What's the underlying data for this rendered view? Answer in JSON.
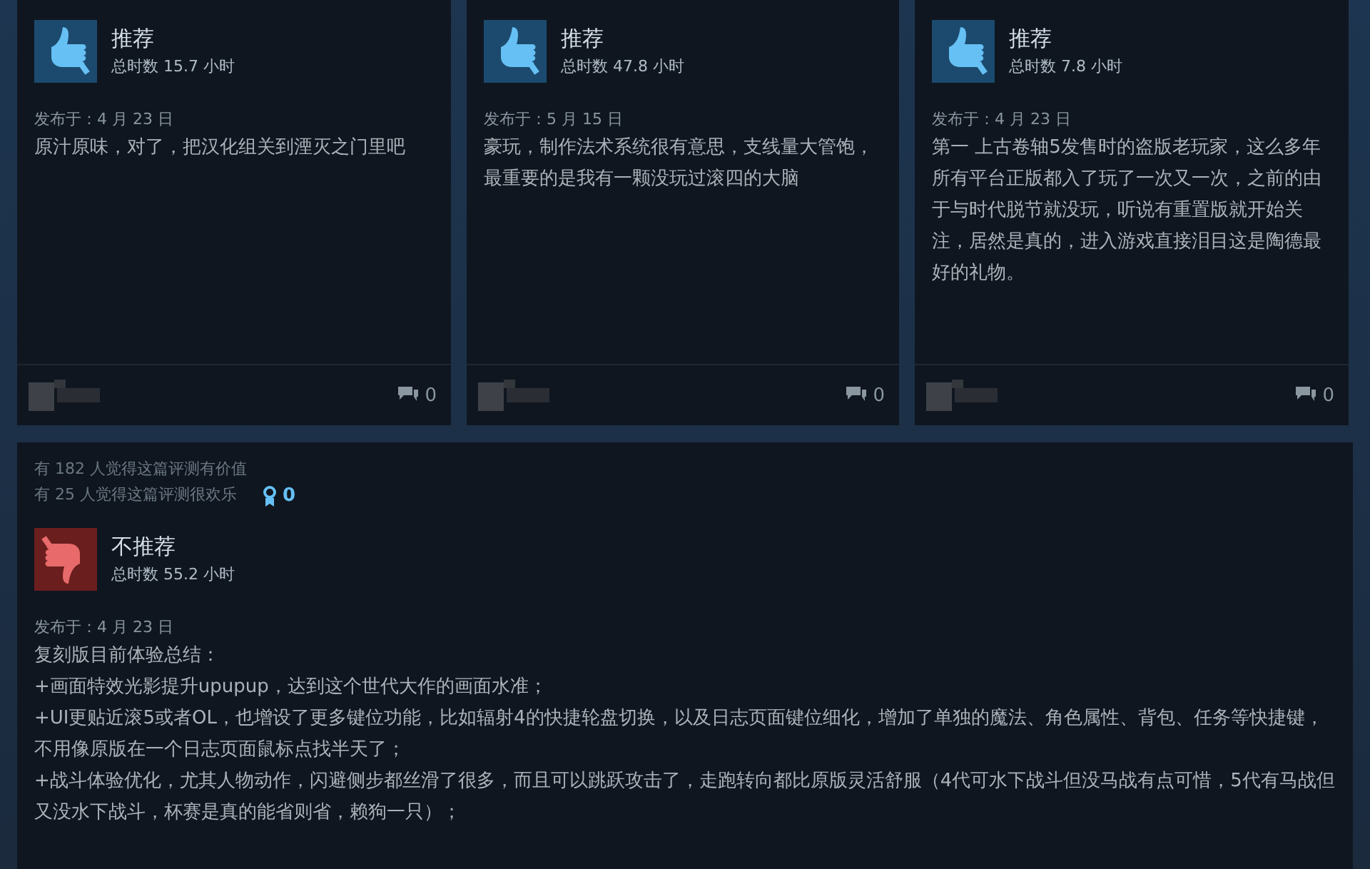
{
  "reviews": [
    {
      "recommended": true,
      "verdict": "推荐",
      "hours": "总时数 15.7 小时",
      "posted": "发布于：4 月 23 日",
      "body": [
        "原汁原味，对了，把汉化组关到湮灭之门里吧"
      ],
      "comments": "0"
    },
    {
      "recommended": true,
      "verdict": "推荐",
      "hours": "总时数 47.8 小时",
      "posted": "发布于：5 月 15 日",
      "body": [
        "豪玩，制作法术系统很有意思，支线量大管饱，最重要的是我有一颗没玩过滚四的大脑"
      ],
      "comments": "0"
    },
    {
      "recommended": true,
      "verdict": "推荐",
      "hours": "总时数 7.8 小时",
      "posted": "发布于：4 月 23 日",
      "body": [
        "第一 上古卷轴5发售时的盗版老玩家，这么多年所有平台正版都入了玩了一次又一次，之前的由于与时代脱节就没玩，听说有重置版就开始关注，居然是真的，进入游戏直接泪目这是陶德最好的礼物。"
      ],
      "comments": "0"
    }
  ],
  "featured": {
    "helpful": "有 182 人觉得这篇评测有价值",
    "funny": "有 25 人觉得这篇评测很欢乐",
    "awards": "0",
    "review": {
      "recommended": false,
      "verdict": "不推荐",
      "hours": "总时数 55.2 小时",
      "posted": "发布于：4 月 23 日",
      "body": [
        "复刻版目前体验总结：",
        "+画面特效光影提升upupup，达到这个世代大作的画面水准；",
        "+UI更贴近滚5或者OL，也增设了更多键位功能，比如辐射4的快捷轮盘切换，以及日志页面键位细化，增加了单独的魔法、角色属性、背包、任务等快捷键，不用像原版在一个日志页面鼠标点找半天了；",
        "+战斗体验优化，尤其人物动作，闪避侧步都丝滑了很多，而且可以跳跃攻击了，走跑转向都比原版灵活舒服（4代可水下战斗但没马战有点可惜，5代有马战但又没水下战斗，杯赛是真的能省则省，赖狗一只）；"
      ]
    }
  }
}
